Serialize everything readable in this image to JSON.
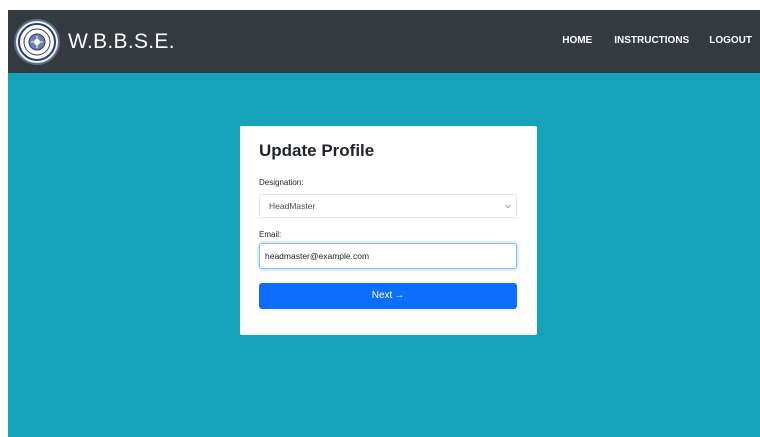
{
  "header": {
    "brand": "W.B.B.S.E.",
    "logo_icon": "wbbse-emblem-icon",
    "nav": {
      "home": "HOME",
      "instructions": "INSTRUCTIONS",
      "logout": "LOGOUT"
    }
  },
  "form": {
    "title": "Update Profile",
    "designation_label": "Designation:",
    "designation_value": "HeadMaster",
    "email_label": "Email:",
    "email_value": "headmaster@example.com",
    "next_label": "Next",
    "next_icon": "arrow-right-icon"
  },
  "colors": {
    "navbar": "#343a40",
    "background": "#14a3b8",
    "primary_button": "#0d6efd",
    "card": "#ffffff"
  }
}
